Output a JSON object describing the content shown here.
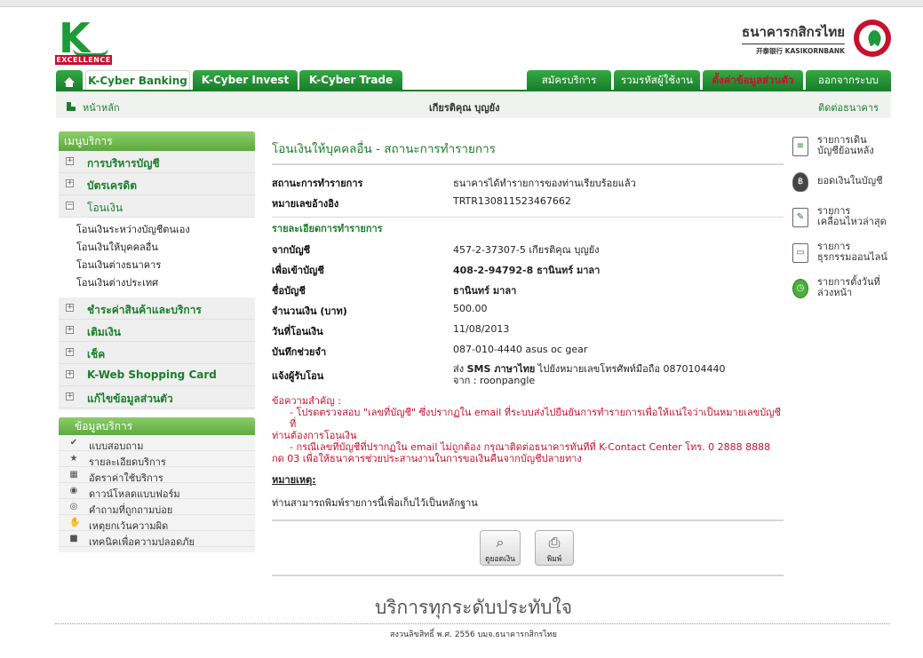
{
  "brand": {
    "logo_text": "EXCELLENCE",
    "name_th": "ธนาคารกสิกรไทย",
    "name_en": "开泰银行 KASIKORNBANK"
  },
  "nav": {
    "tabs": [
      {
        "label": "K-Cyber Banking",
        "active": true
      },
      {
        "label": "K-Cyber Invest",
        "active": false
      },
      {
        "label": "K-Cyber Trade",
        "active": false
      }
    ],
    "right_tabs": [
      {
        "label": "สมัครบริการ"
      },
      {
        "label": "รวมรหัสผู้ใช้งาน"
      },
      {
        "label": "ตั้งค่าข้อมูลส่วนตัว"
      },
      {
        "label": "ออกจากระบบ"
      }
    ]
  },
  "subbar": {
    "home": "หน้าหลัก",
    "user": "เกียรติคุณ บุญยัง",
    "contact": "ติดต่อธนาคาร"
  },
  "menu": {
    "title": "เมนูบริการ",
    "items": [
      {
        "label": "การบริหารบัญชี",
        "sign": "+"
      },
      {
        "label": "บัตรเครดิต",
        "sign": "+"
      },
      {
        "label": "โอนเงิน",
        "sign": "−"
      },
      {
        "label": "ชำระค่าสินค้าและบริการ",
        "sign": "+"
      },
      {
        "label": "เติมเงิน",
        "sign": "+"
      },
      {
        "label": "เช็ค",
        "sign": "+"
      },
      {
        "label": "K-Web Shopping Card",
        "sign": "+"
      },
      {
        "label": "แก้ไขข้อมูลส่วนตัว",
        "sign": "+"
      }
    ],
    "transfer_sub": [
      "โอนเงินระหว่างบัญชีตนเอง",
      "โอนเงินให้บุคคลอื่น",
      "โอนเงินต่างธนาคาร",
      "โอนเงินต่างประเทศ"
    ]
  },
  "info": {
    "title": "ข้อมูลบริการ",
    "items": [
      {
        "label": "แบบสอบถาม",
        "icon": "checkmark-icon",
        "glyph": "✔"
      },
      {
        "label": "รายละเอียดบริการ",
        "icon": "star-icon",
        "glyph": "★"
      },
      {
        "label": "อัตราค่าใช้บริการ",
        "icon": "calculator-icon",
        "glyph": "▦"
      },
      {
        "label": "ดาวน์โหลดแบบฟอร์ม",
        "icon": "download-icon",
        "glyph": "◉"
      },
      {
        "label": "คำถามที่ถูกถามบ่อย",
        "icon": "question-icon",
        "glyph": "◎"
      },
      {
        "label": "เหตุยกเว้นความผิด",
        "icon": "handshake-icon",
        "glyph": "✋"
      },
      {
        "label": "เทคนิคเพื่อความปลอดภัย",
        "icon": "lock-icon",
        "glyph": "■"
      }
    ]
  },
  "main": {
    "title": "โอนเงินให้บุคคลอื่น - สถานะการทำรายการ",
    "status_label": "สถานะการทำรายการ",
    "status_value": "ธนาคารได้ทำรายการของท่านเรียบร้อยแล้ว",
    "ref_label": "หมายเลขอ้างอิง",
    "ref_value": "TRTR130811523467662",
    "detail_title": "รายละเอียดการทำรายการ",
    "details": [
      {
        "k": "จากบัญชี",
        "v": "457-2-37307-5 เกียรติคุณ บุญยัง",
        "bold": false
      },
      {
        "k": "เพื่อเข้าบัญชี",
        "v": "408-2-94792-8 ธานินทร์ มาลา",
        "bold": true
      },
      {
        "k": "ชื่อบัญชี",
        "v": "ธานินทร์ มาลา",
        "bold": true
      },
      {
        "k": "จำนวนเงิน (บาท)",
        "v": "500.00",
        "bold": false
      },
      {
        "k": "วันที่โอนเงิน",
        "v": "11/08/2013",
        "bold": false
      },
      {
        "k": "บันทึกช่วยจำ",
        "v": "087-010-4440 asus oc gear",
        "bold": false
      }
    ],
    "notify_label": "แจ้งผู้รับโอน",
    "notify_line1_pre": "ส่ง ",
    "notify_line1_sms": "SMS ภาษาไทย",
    "notify_line1_post": " ไปยังหมายเลขโทรศัพท์มือถือ 0870104440",
    "notify_line2": "จาก : roonpangle",
    "notice_title": "ข้อความสำคัญ :",
    "notice_1": "- โปรดตรวจสอบ \"เลขที่บัญชี\" ซึ่งปรากฏใน email ที่ระบบส่งไปยืนยันการทำรายการเพื่อให้แน่ใจว่าเป็นหมายเลขบัญชีที่",
    "notice_1b": "ท่านต้องการโอนเงิน",
    "notice_2": "- กรณีเลขที่บัญชีที่ปรากฏใน email ไม่ถูกต้อง กรุณาติดต่อธนาคารทันทีที่ K-Contact Center โทร. 0 2888 8888",
    "notice_2b": "กด 03 เพื่อให้ธนาคารช่วยประสานงานในการขอเงินคืนจากบัญชีปลายทาง",
    "remark_title": "หมายเหตุ:",
    "remark_text": "ท่านสามารถพิมพ์รายการนี้เพื่อเก็บไว้เป็นหลักฐาน",
    "btn_view": "ดูยอดเงิน",
    "btn_print": "พิมพ์"
  },
  "rpanel": [
    {
      "label": "รายการเดิน\nบัญชีย้อนหลัง",
      "icon": "statement-icon",
      "glyph": "≡",
      "style": ""
    },
    {
      "label": "ยอดเงินในบัญชี",
      "icon": "money-bag-icon",
      "glyph": "฿",
      "style": "dark"
    },
    {
      "label": "รายการ\nเคลื่อนไหวล่าสุด",
      "icon": "recent-list-icon",
      "glyph": "✎",
      "style": ""
    },
    {
      "label": "รายการ\nธุรกรรมออนไลน์",
      "icon": "monitor-icon",
      "glyph": "▭",
      "style": ""
    },
    {
      "label": "รายการตั้งวันที่\nล่วงหน้า",
      "icon": "clock-icon",
      "glyph": "◷",
      "style": "green"
    }
  ],
  "footer": {
    "slogan": "บริการทุกระดับประทับใจ",
    "copyright": "สงวนลิขสิทธิ์ พ.ศ. 2556 บมจ.ธนาคารกสิกรไทย"
  }
}
